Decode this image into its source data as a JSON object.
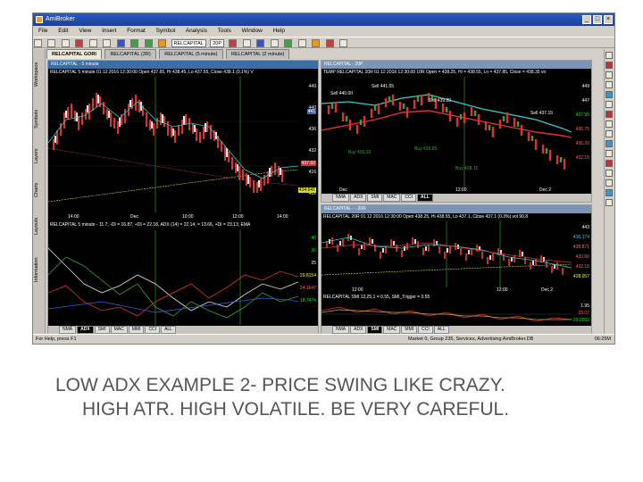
{
  "window": {
    "title": "AmiBroker"
  },
  "menu": [
    "File",
    "Edit",
    "View",
    "Insert",
    "Format",
    "Symbol",
    "Analysis",
    "Tools",
    "Window",
    "Help"
  ],
  "toolbar": {
    "symbol": "RELCAPITAL",
    "interval": "20P"
  },
  "sidebar": [
    "Workspace",
    "Symbols",
    "Layers",
    "Charts",
    "Layouts",
    "Information"
  ],
  "tabs": [
    {
      "label": "RELCAPITAL GORI"
    },
    {
      "label": "RELCAPITAL (2R)"
    },
    {
      "label": "RELCAPITAL (5 minute)"
    },
    {
      "label": "RELCAPITAL (2 minute)"
    }
  ],
  "panes": {
    "left": {
      "title": "RELCAPITAL - 5 minute",
      "info": "RELCAPITAL 5 minute 01 12 2016 12:30:00 Open 437.65, Hi 438.45, Lo 437.55, Close 438.1 (0.1%) V",
      "price_axis": [
        "449",
        "440",
        "436",
        "432",
        "416",
        "412"
      ],
      "price_tags": [
        "441",
        "437.92",
        "434.641"
      ],
      "ind_label": "RELCAPITAL 5 minute - 11.7, -DI = 16.87, +DI = 22.18, ADX (14) = 22.14, = 13.66, +DI = 23.13, EMA",
      "ind_axis": [
        "40",
        "30",
        "25",
        "29.8154",
        "24.1647",
        "18.7474"
      ],
      "time_axis": [
        "14:00",
        "Dec",
        "10:00",
        "12:00",
        "14:00"
      ],
      "tabs": [
        "NMA",
        "ADX",
        "SMI",
        "MAC",
        "MMI",
        "CCI",
        "ALL"
      ],
      "active_tab": "ADX"
    },
    "top_right": {
      "title": "RELCAPITAL - 20P",
      "info": "TEMP RELCAPITAL 20R 01 12 2016 12:30:00 10R Open = 438.25, Hi = 438.55, Lo = 437.85, Close = 438.35 vo",
      "price_axis": [
        "449",
        "447",
        "437.95",
        "436.75",
        "436.20",
        "432.15"
      ],
      "annotations": [
        "Sell 440.00",
        "Sell 441.55",
        "Sell 439.20",
        "Sell 437.15",
        "Buy 436.25",
        "Buy 435.85",
        "Buy 438.15"
      ],
      "time_axis": [
        "Dec",
        "12:00",
        "Dec 2"
      ],
      "tabs": [
        "NMA",
        "ADX",
        "SMI",
        "MAC",
        "CCI",
        "ALL"
      ],
      "active_tab": "ALL"
    },
    "bottom_right": {
      "title": "RELCAPITAL - - 20R",
      "info": "RELCAPITAL 20R 01 12 2016 12:30:00 Open 438.25, Hi 438.55, Lo 437.1, Close 437.1 (0.3%) vol 90.8",
      "price_axis": [
        "443",
        "436.174",
        "435.871",
        "432.66",
        "432.15",
        "428.057"
      ],
      "ind_label": "RELCAPITAL SMI 12,25,1 = 0.55, SMI_Trigger = 0.55",
      "ind_axis": [
        "1.95",
        "-23.07",
        "-29.2052"
      ],
      "time_axis": [
        "12:00",
        "12:00",
        "Dec 2"
      ],
      "tabs": [
        "NMA",
        "ADX",
        "SMI",
        "MAC",
        "MMI",
        "CCI",
        "ALL"
      ],
      "active_tab": "SMI"
    }
  },
  "status": {
    "help": "For Help, press F1",
    "info": "Market 0, Group 235, Services, Advertising AmiBroker.DB",
    "clock": "06:25M"
  },
  "caption": {
    "line1": "LOW ADX EXAMPLE 2- PRICE SWING LIKE CRAZY.",
    "line2": "HIGH ATR. HIGH VOLATILE. BE VERY CAREFUL."
  }
}
